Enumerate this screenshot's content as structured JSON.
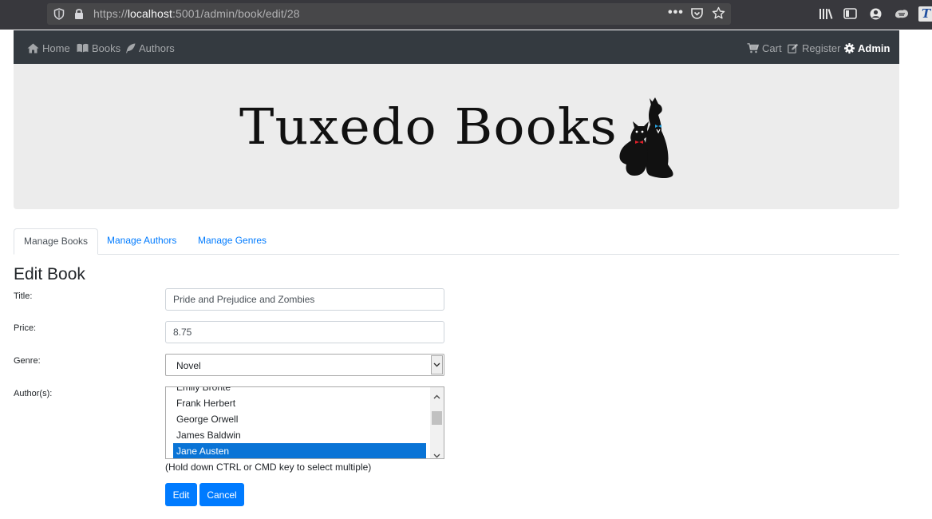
{
  "browser": {
    "url_prefix": "https://",
    "url_host": "localhost",
    "url_rest": ":5001/admin/book/edit/28"
  },
  "navbar": {
    "left": [
      {
        "label": "Home",
        "icon": "home-icon"
      },
      {
        "label": "Books",
        "icon": "book-icon"
      },
      {
        "label": "Authors",
        "icon": "feather-icon"
      }
    ],
    "right": [
      {
        "label": "Cart",
        "icon": "cart-icon"
      },
      {
        "label": "Register",
        "icon": "edit-icon"
      },
      {
        "label": "Admin",
        "icon": "gear-icon",
        "active": true
      }
    ]
  },
  "banner": {
    "logo_text": "Tuxedo Books"
  },
  "tabs": [
    {
      "label": "Manage Books",
      "active": true
    },
    {
      "label": "Manage Authors",
      "active": false
    },
    {
      "label": "Manage Genres",
      "active": false
    }
  ],
  "form": {
    "heading": "Edit Book",
    "title_label": "Title:",
    "title_value": "Pride and Prejudice and Zombies",
    "price_label": "Price:",
    "price_value": "8.75",
    "genre_label": "Genre:",
    "genre_value": "Novel",
    "authors_label": "Author(s):",
    "authors_options": [
      {
        "label": "Emily Bronte",
        "selected": false
      },
      {
        "label": "Frank Herbert",
        "selected": false
      },
      {
        "label": "George Orwell",
        "selected": false
      },
      {
        "label": "James Baldwin",
        "selected": false
      },
      {
        "label": "Jane Austen",
        "selected": true
      }
    ],
    "authors_help": "(Hold down CTRL or CMD key to select multiple)",
    "edit_label": "Edit",
    "cancel_label": "Cancel"
  },
  "colors": {
    "navbar_bg": "#343a40",
    "primary": "#007bff",
    "selected_option": "#0a74d6",
    "banner_bg": "#ececec"
  }
}
